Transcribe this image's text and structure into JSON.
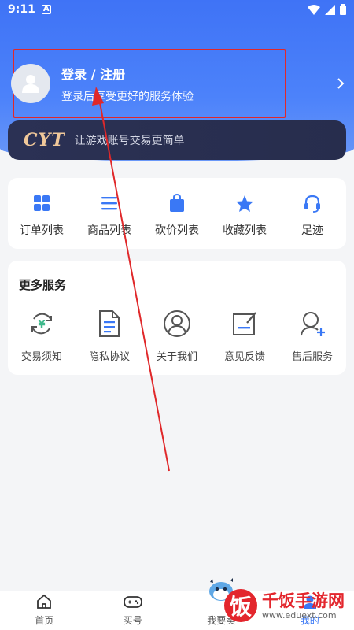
{
  "status_bar": {
    "time": "9:11",
    "notif_glyph": "A"
  },
  "profile": {
    "title": "登录 / 注册",
    "subtitle": "登录后享受更好的服务体验"
  },
  "banner": {
    "logo": "CYT",
    "slogan": "让游戏账号交易更简单"
  },
  "quick_menu": [
    {
      "label": "订单列表",
      "icon": "grid-icon"
    },
    {
      "label": "商品列表",
      "icon": "list-icon"
    },
    {
      "label": "砍价列表",
      "icon": "bag-icon"
    },
    {
      "label": "收藏列表",
      "icon": "star-icon"
    },
    {
      "label": "足迹",
      "icon": "headset-icon"
    }
  ],
  "more_services": {
    "title": "更多服务",
    "items": [
      {
        "label": "交易须知",
        "icon": "yuan-cycle-icon"
      },
      {
        "label": "隐私协议",
        "icon": "document-icon"
      },
      {
        "label": "关于我们",
        "icon": "user-circle-icon"
      },
      {
        "label": "意见反馈",
        "icon": "feedback-icon"
      },
      {
        "label": "售后服务",
        "icon": "support-icon"
      }
    ]
  },
  "tabbar": [
    {
      "label": "首页",
      "icon": "home-icon"
    },
    {
      "label": "买号",
      "icon": "gamepad-icon"
    },
    {
      "label": "我要卖",
      "icon": "mascot-icon"
    },
    {
      "label": "我的",
      "icon": "profile-icon"
    }
  ],
  "watermark": {
    "badge": "饭",
    "name": "千饭手游网",
    "url": "www.eduext.com"
  },
  "colors": {
    "brand_blue": "#3f73f6",
    "highlight_red": "#e0282a",
    "banner_bg": "#2b3154",
    "banner_gold": "#f0c89a"
  }
}
